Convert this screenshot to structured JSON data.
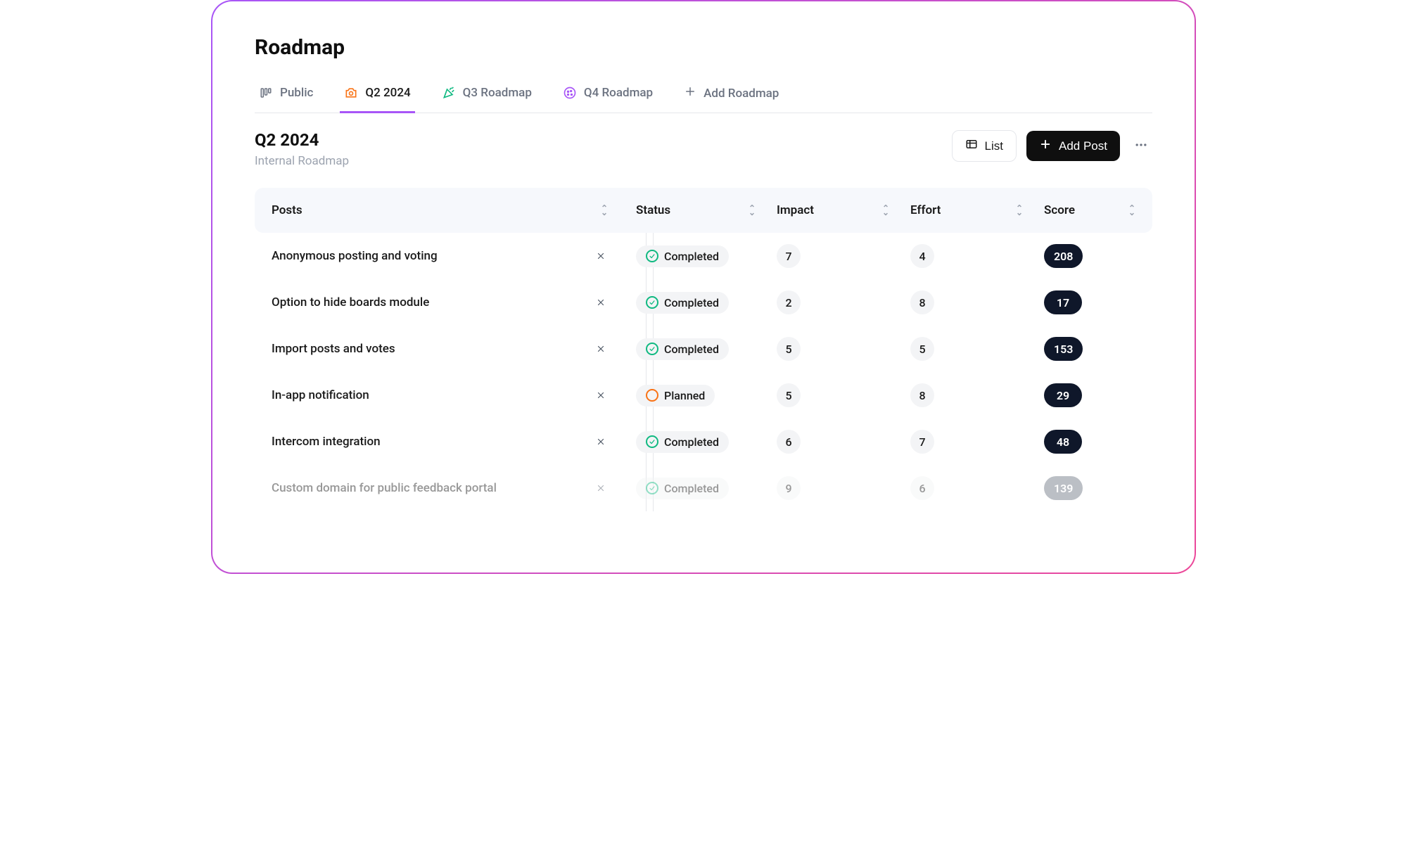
{
  "page_title": "Roadmap",
  "tabs": [
    {
      "label": "Public",
      "icon": "columns"
    },
    {
      "label": "Q2 2024",
      "icon": "camera",
      "active": true
    },
    {
      "label": "Q3 Roadmap",
      "icon": "confetti"
    },
    {
      "label": "Q4 Roadmap",
      "icon": "cookie"
    }
  ],
  "add_roadmap_label": "Add Roadmap",
  "section": {
    "title": "Q2 2024",
    "subtitle": "Internal Roadmap"
  },
  "actions": {
    "list_label": "List",
    "add_post_label": "Add Post"
  },
  "table": {
    "headers": {
      "posts": "Posts",
      "status": "Status",
      "impact": "Impact",
      "effort": "Effort",
      "score": "Score"
    },
    "rows": [
      {
        "title": "Anonymous posting and voting",
        "status": "Completed",
        "status_type": "completed",
        "impact": "7",
        "effort": "4",
        "score": "208"
      },
      {
        "title": "Option to hide boards module",
        "status": "Completed",
        "status_type": "completed",
        "impact": "2",
        "effort": "8",
        "score": "17"
      },
      {
        "title": "Import posts and votes",
        "status": "Completed",
        "status_type": "completed",
        "impact": "5",
        "effort": "5",
        "score": "153"
      },
      {
        "title": "In-app notification",
        "status": "Planned",
        "status_type": "planned",
        "impact": "5",
        "effort": "8",
        "score": "29"
      },
      {
        "title": "Intercom integration",
        "status": "Completed",
        "status_type": "completed",
        "impact": "6",
        "effort": "7",
        "score": "48"
      },
      {
        "title": "Custom domain for public feedback portal",
        "status": "Completed",
        "status_type": "completed",
        "impact": "9",
        "effort": "6",
        "score": "139",
        "faded": true
      }
    ]
  }
}
